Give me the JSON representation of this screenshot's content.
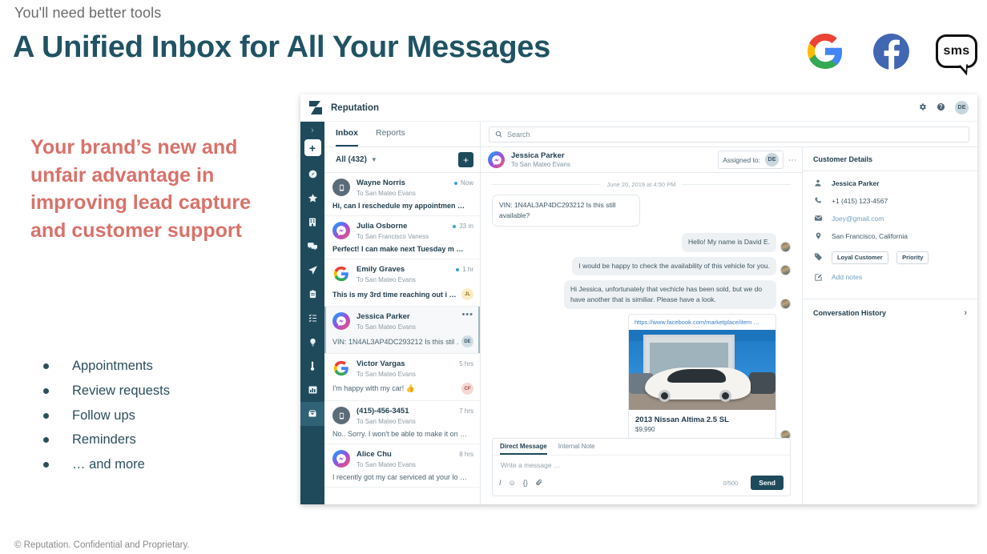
{
  "slide": {
    "eyebrow": "You'll need better tools",
    "headline": "A Unified Inbox for All Your Messages",
    "lead": "Your brand’s new and unfair advantage in improving lead capture and customer support",
    "bullets": [
      "Appointments",
      "Review requests",
      "Follow ups",
      "Reminders",
      "… and more"
    ],
    "footer": "© Reputation. Confidential and Proprietary.",
    "channels": [
      {
        "name": "google-icon",
        "label": "G"
      },
      {
        "name": "facebook-icon",
        "label": "f"
      },
      {
        "name": "sms-icon",
        "label": "sms"
      }
    ],
    "colors": {
      "headline": "#205363",
      "lead": "#d8726a",
      "bullet_text": "#2d4f5c",
      "app_dark": "#1f4a5b"
    }
  },
  "app": {
    "title": "Reputation",
    "titlebar_icons": [
      "gear-icon",
      "help-icon"
    ],
    "user_initials": "DE",
    "rail": {
      "collapse": "›",
      "add": "+",
      "items": [
        "dashboard-icon",
        "star-icon",
        "business-icon",
        "chat-icon",
        "send-icon",
        "clipboard-icon",
        "list-icon",
        "bulb-icon",
        "thermometer-icon",
        "chart-icon",
        "inbox-icon"
      ],
      "active_index": 10
    },
    "tabs": [
      {
        "label": "Inbox",
        "active": true
      },
      {
        "label": "Reports",
        "active": false
      }
    ],
    "search": {
      "placeholder": "Search",
      "value": ""
    },
    "filter": {
      "label": "All  (432)",
      "compose": "+"
    },
    "conversations": [
      {
        "avatar": "sms",
        "name": "Wayne Norris",
        "to": "To San Mateo Evans",
        "unread": true,
        "time": "Now",
        "snippet": "Hi, can I reschedule my appointmen …",
        "bold": true,
        "chip": "",
        "chip_class": "",
        "selected": false,
        "menu": false
      },
      {
        "avatar": "messenger",
        "name": "Julia Osborne",
        "to": "To San Francisco Vaness",
        "unread": true,
        "time": "33 m",
        "snippet": "Perfect! I can make next Tuesday m …",
        "bold": true,
        "chip": "",
        "chip_class": "",
        "selected": false,
        "menu": false
      },
      {
        "avatar": "google",
        "name": "Emily Graves",
        "to": "To San Mateo Evans",
        "unread": true,
        "time": "1 hr",
        "snippet": "This is my 3rd time reaching out i …",
        "bold": true,
        "chip": "JL",
        "chip_class": "chip-jl",
        "selected": false,
        "menu": false
      },
      {
        "avatar": "messenger",
        "name": "Jessica Parker",
        "to": "To San Mateo Evans",
        "unread": false,
        "time": "",
        "snippet": "VIN: 1N4AL3AP4DC293212 Is this stil …",
        "bold": false,
        "chip": "DE",
        "chip_class": "chip-de",
        "selected": true,
        "menu": true
      },
      {
        "avatar": "google",
        "name": "Victor Vargas",
        "to": "To San Mateo Evans",
        "unread": false,
        "time": "5 hrs",
        "snippet": "I'm happy with my car! 👍",
        "bold": false,
        "chip": "CF",
        "chip_class": "chip-cf",
        "selected": false,
        "menu": false
      },
      {
        "avatar": "sms",
        "name": "(415)-456-3451",
        "to": "To San Mateo Evans",
        "unread": false,
        "time": "7 hrs",
        "snippet": "No.. Sorry. I won't be able to make it on …",
        "bold": false,
        "chip": "",
        "chip_class": "",
        "selected": false,
        "menu": false
      },
      {
        "avatar": "messenger",
        "name": "Alice Chu",
        "to": "To San Mateo Evans",
        "unread": false,
        "time": "8 hrs",
        "snippet": "I recently got my car serviced at your lo …",
        "bold": false,
        "chip": "",
        "chip_class": "",
        "selected": false,
        "menu": false
      }
    ],
    "conversation_header": {
      "name": "Jessica Parker",
      "to": "To San Mateo Evans",
      "assigned_label": "Assigned to:",
      "assigned_initials": "DE"
    },
    "thread": {
      "date_separator": "June 20, 2019 at 4:50 PM",
      "messages": [
        {
          "dir": "in",
          "text": "VIN: 1N4AL3AP4DC293212 Is this still available?"
        },
        {
          "dir": "out",
          "text": "Hello! My name is David E."
        },
        {
          "dir": "out",
          "text": "I would be happy to check the availability of this vehicle for you."
        },
        {
          "dir": "out",
          "text": "Hi Jessica, unfortunately that vechicle has been sold, but we do have another that is similiar. Please have a look."
        }
      ],
      "card": {
        "url": "https://www.facebook.com/marketplace/item …",
        "title": "2013 Nissan Altima 2.5 SL",
        "price": "$9,990"
      }
    },
    "composer": {
      "tabs": [
        {
          "label": "Direct Message",
          "active": true
        },
        {
          "label": "Internal Note",
          "active": false
        }
      ],
      "placeholder": "Write a message …",
      "tools": [
        "italic-icon",
        "emoji-icon",
        "variable-icon",
        "attachment-icon"
      ],
      "counter": "0/500",
      "send_label": "Send"
    },
    "details": {
      "title": "Customer Details",
      "rows": [
        {
          "icon": "person-icon",
          "value": "Jessica Parker",
          "style": "bold"
        },
        {
          "icon": "phone-icon",
          "value": "+1 (415) 123-4567",
          "style": ""
        },
        {
          "icon": "email-icon",
          "value": "Joey@gmail.com",
          "style": "link"
        },
        {
          "icon": "location-icon",
          "value": "San Francisco, California",
          "style": ""
        }
      ],
      "tags_icon": "tag-icon",
      "tags": [
        "Loyal Customer",
        "Priority"
      ],
      "notes_icon": "note-icon",
      "notes_label": "Add notes",
      "history_label": "Conversation History",
      "history_chevron": "›"
    }
  }
}
